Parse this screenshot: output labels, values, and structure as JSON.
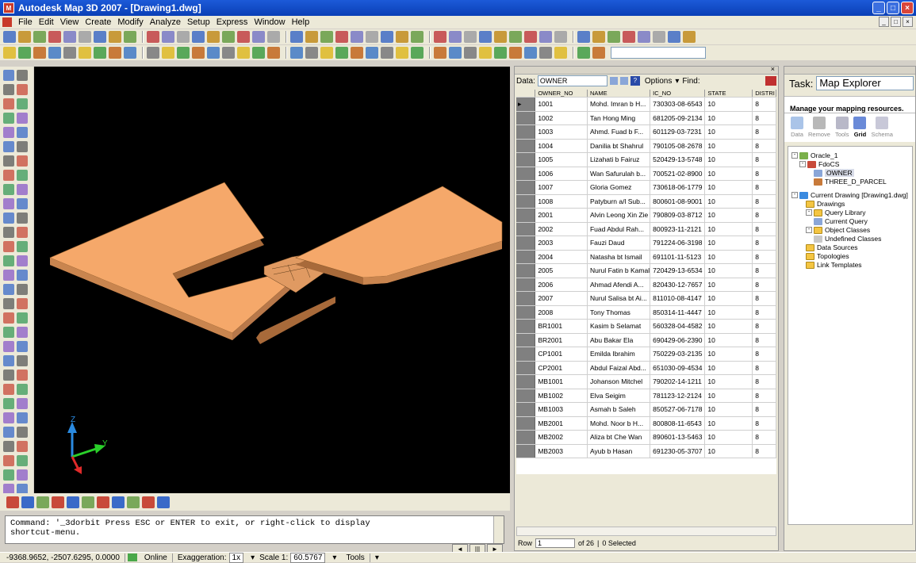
{
  "window": {
    "title": "Autodesk Map 3D 2007 - [Drawing1.dwg]"
  },
  "menu": [
    "File",
    "Edit",
    "View",
    "Create",
    "Modify",
    "Analyze",
    "Setup",
    "Express",
    "Window",
    "Help"
  ],
  "command": {
    "line1": "Command: '_3dorbit Press ESC or ENTER to exit, or right-click to display",
    "line2": "shortcut-menu."
  },
  "axes": {
    "z": "Z",
    "y": "Y"
  },
  "status": {
    "coords": "-9368.9652, -2507.6295, 0.0000",
    "online": "Online",
    "exaggeration_label": "Exaggeration:",
    "exaggeration_value": "1x",
    "scale_label": "Scale 1:",
    "scale_value": "60.5767",
    "tools": "Tools"
  },
  "data_manager": {
    "data_label": "Data:",
    "data_value": "OWNER",
    "options": "Options",
    "find": "Find:",
    "columns": [
      "OWNER_NO",
      "NAME",
      "IC_NO",
      "STATE",
      "DISTRI"
    ],
    "rows": [
      [
        "1001",
        "Mohd. Imran b H...",
        "730303-08-6543",
        "10",
        "8"
      ],
      [
        "1002",
        "Tan Hong Ming",
        "681205-09-2134",
        "10",
        "8"
      ],
      [
        "1003",
        "Ahmd. Fuad b F...",
        "601129-03-7231",
        "10",
        "8"
      ],
      [
        "1004",
        "Danilia bt Shahrul",
        "790105-08-2678",
        "10",
        "8"
      ],
      [
        "1005",
        "Lizahati b Fairuz",
        "520429-13-5748",
        "10",
        "8"
      ],
      [
        "1006",
        "Wan Safurulah b...",
        "700521-02-8900",
        "10",
        "8"
      ],
      [
        "1007",
        "Gloria Gomez",
        "730618-06-1779",
        "10",
        "8"
      ],
      [
        "1008",
        "Patyburn a/l Sub...",
        "800601-08-9001",
        "10",
        "8"
      ],
      [
        "2001",
        "Alvin Leong Xin Zie",
        "790809-03-8712",
        "10",
        "8"
      ],
      [
        "2002",
        "Fuad Abdul Rah...",
        "800923-11-2121",
        "10",
        "8"
      ],
      [
        "2003",
        "Fauzi Daud",
        "791224-06-3198",
        "10",
        "8"
      ],
      [
        "2004",
        "Natasha bt Ismail",
        "691101-11-5123",
        "10",
        "8"
      ],
      [
        "2005",
        "Nurul Fatin b Kamal",
        "720429-13-6534",
        "10",
        "8"
      ],
      [
        "2006",
        "Ahmad Afendi A...",
        "820430-12-7657",
        "10",
        "8"
      ],
      [
        "2007",
        "Nurul Salisa bt Ai...",
        "811010-08-4147",
        "10",
        "8"
      ],
      [
        "2008",
        "Tony Thomas",
        "850314-11-4447",
        "10",
        "8"
      ],
      [
        "BR1001",
        "Kasim b Selamat",
        "560328-04-4582",
        "10",
        "8"
      ],
      [
        "BR2001",
        "Abu Bakar Ela",
        "690429-06-2390",
        "10",
        "8"
      ],
      [
        "CP1001",
        "Emilda Ibrahim",
        "750229-03-2135",
        "10",
        "8"
      ],
      [
        "CP2001",
        "Abdul Faizal Abd...",
        "651030-09-4534",
        "10",
        "8"
      ],
      [
        "MB1001",
        "Johanson Mitchel",
        "790202-14-1211",
        "10",
        "8"
      ],
      [
        "MB1002",
        "Elva Seigim",
        "781123-12-2124",
        "10",
        "8"
      ],
      [
        "MB1003",
        "Asmah b Saleh",
        "850527-06-7178",
        "10",
        "8"
      ],
      [
        "MB2001",
        "Mohd. Noor b H...",
        "800808-11-6543",
        "10",
        "8"
      ],
      [
        "MB2002",
        "Aliza bt Che Wan",
        "890601-13-5463",
        "10",
        "8"
      ],
      [
        "MB2003",
        "Ayub b Hasan",
        "691230-05-3707",
        "10",
        "8"
      ]
    ],
    "row_label": "Row",
    "row_value": "1",
    "row_of": "of 26",
    "selected": "0 Selected"
  },
  "task": {
    "label": "Task:",
    "value": "Map Explorer",
    "heading": "Manage your mapping resources.",
    "tools": [
      "Data",
      "Remove",
      "Tools",
      "Grid",
      "Schema"
    ],
    "tree": [
      "Oracle_1",
      "FdoCS",
      "OWNER",
      "THREE_D_PARCEL",
      "Current Drawing [Drawing1.dwg]",
      "Drawings",
      "Query Library",
      "Current Query",
      "Object Classes",
      "Undefined Classes",
      "Data Sources",
      "Topologies",
      "Link Templates"
    ]
  },
  "colors": {
    "parcel": "#f5a86a",
    "parcel_edge": "#a86a3a",
    "viewport": "#000000",
    "title_blue": "#0a3fb6"
  }
}
